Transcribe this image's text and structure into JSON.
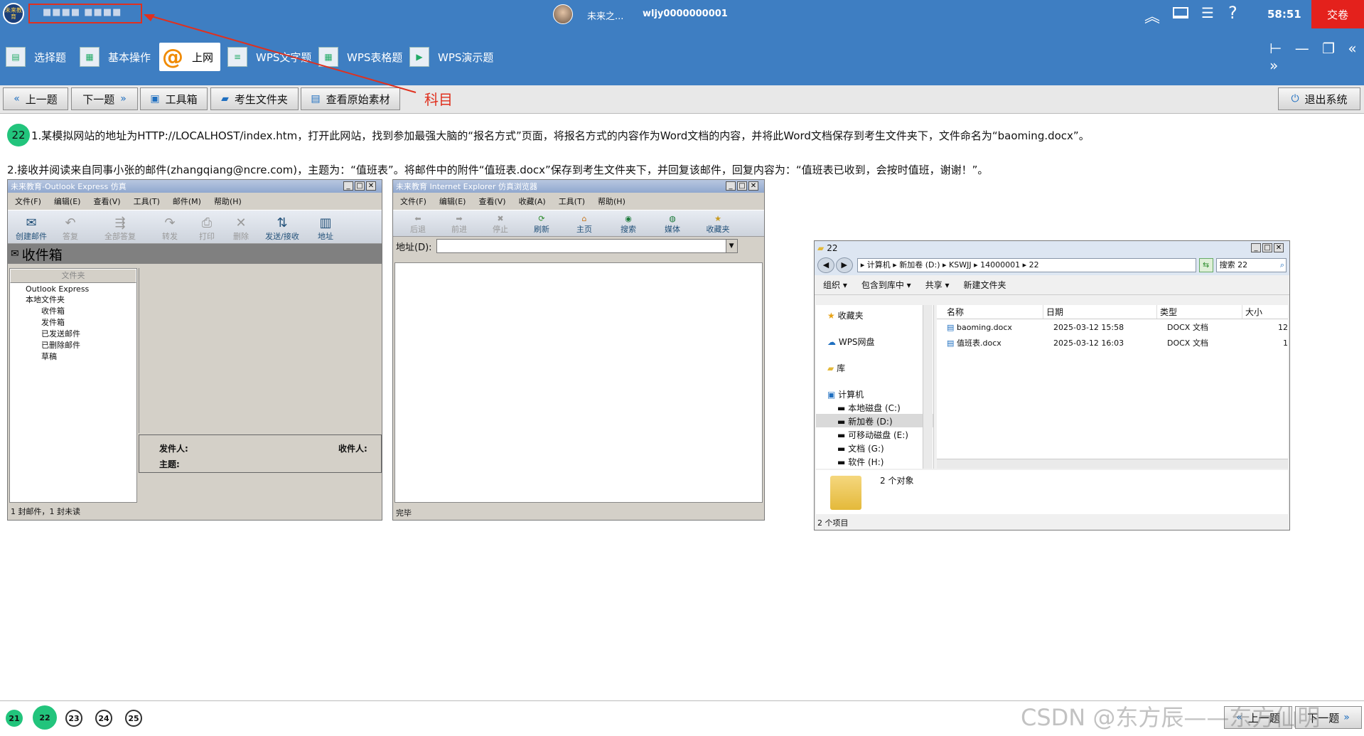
{
  "topbar": {
    "logo_text": "未来教育",
    "account_blurred": "■■■■ ■■■■",
    "user_name": "未来之...",
    "user_id": "wljy0000000001",
    "timer": "58:51",
    "submit_label": "交卷"
  },
  "menu": {
    "items": [
      {
        "label": "选择题"
      },
      {
        "label": "基本操作"
      },
      {
        "label": "上网"
      },
      {
        "label": "WPS文字题"
      },
      {
        "label": "WPS表格题"
      },
      {
        "label": "WPS演示题"
      }
    ]
  },
  "toolbar": {
    "prev": "上一题",
    "next": "下一题",
    "toolbox": "工具箱",
    "student_folder": "考生文件夹",
    "view_source": "查看原始素材",
    "exit": "退出系统"
  },
  "annotation": {
    "label": "科目",
    "color": "#e0301e"
  },
  "question": {
    "number": "22",
    "line1": "1.某模拟网站的地址为HTTP://LOCALHOST/index.htm，打开此网站，找到参加最强大脑的“报名方式”页面，将报名方式的内容作为Word文档的内容，并将此Word文档保存到考生文件夹下，文件命名为“baoming.docx”。",
    "line2": "2.接收并阅读来自同事小张的邮件(zhangqiang@ncre.com)，主题为：“值班表”。将邮件中的附件“值班表.docx”保存到考生文件夹下，并回复该邮件，回复内容为：“值班表已收到，会按时值班，谢谢！”。"
  },
  "outlook": {
    "title": "未来教育-Outlook Express 仿真",
    "menus": [
      "文件(F)",
      "编辑(E)",
      "查看(V)",
      "工具(T)",
      "邮件(M)",
      "帮助(H)"
    ],
    "buttons": [
      "创建邮件",
      "答复",
      "全部答复",
      "转发",
      "打印",
      "删除",
      "发送/接收",
      "地址"
    ],
    "folder_header": "收件箱",
    "folders_label": "文件夹",
    "tree": [
      "Outlook Express",
      "本地文件夹",
      "收件箱",
      "发件箱",
      "已发送邮件",
      "已删除邮件",
      "草稿"
    ],
    "from_label": "发件人:",
    "to_label": "收件人:",
    "subject_label": "主题:",
    "status": "1 封邮件，1 封未读"
  },
  "ie": {
    "title": "未来教育 Internet Explorer 仿真浏览器",
    "menus": [
      "文件(F)",
      "编辑(E)",
      "查看(V)",
      "收藏(A)",
      "工具(T)",
      "帮助(H)"
    ],
    "buttons": [
      "后退",
      "前进",
      "停止",
      "刷新",
      "主页",
      "搜索",
      "媒体",
      "收藏夹"
    ],
    "address_label": "地址(D):",
    "address_value": "",
    "status": "完毕"
  },
  "explorer": {
    "title": "22",
    "path": "▸ 计算机 ▸ 新加卷 (D:) ▸ KSWJJ ▸ 14000001 ▸ 22",
    "search_placeholder": "搜索 22",
    "actions": [
      "组织 ▾",
      "包含到库中 ▾",
      "共享 ▾",
      "新建文件夹"
    ],
    "nav": [
      "收藏夹",
      "WPS网盘",
      "库",
      "计算机",
      "本地磁盘 (C:)",
      "新加卷 (D:)",
      "可移动磁盘 (E:)",
      "文档 (G:)",
      "软件 (H:)"
    ],
    "columns": [
      "名称",
      "日期",
      "类型",
      "大小"
    ],
    "files": [
      {
        "name": "baoming.docx",
        "date": "2025-03-12 15:58",
        "type": "DOCX 文档",
        "size": "12"
      },
      {
        "name": "值班表.docx",
        "date": "2025-03-12 16:03",
        "type": "DOCX 文档",
        "size": "1"
      }
    ],
    "count_text": "2 个对象",
    "status": "2 个项目"
  },
  "bottom": {
    "numbers": [
      "21",
      "22",
      "23",
      "24",
      "25"
    ],
    "prev": "上一题",
    "next": "下一题",
    "watermark": "CSDN @东方辰——东方仙明"
  }
}
